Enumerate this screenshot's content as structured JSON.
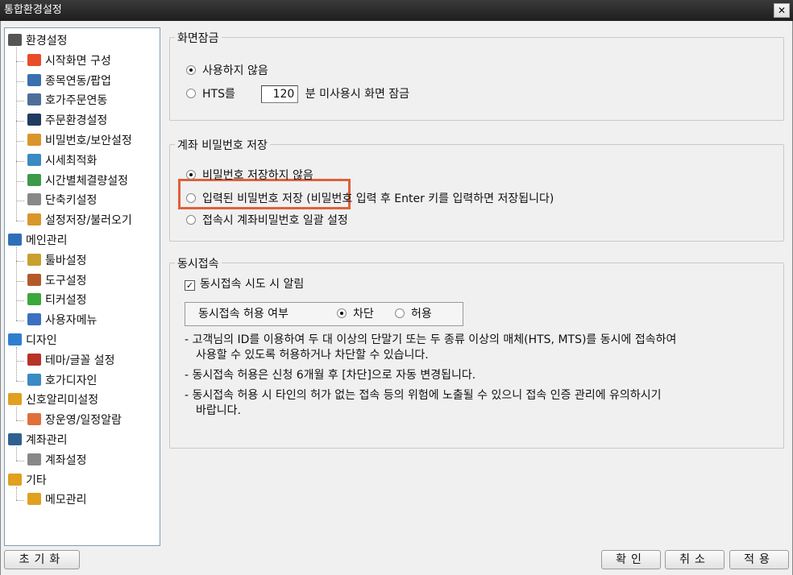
{
  "window": {
    "title": "통합환경설정",
    "close_label": "✕"
  },
  "tree": [
    {
      "label": "환경설정",
      "icon": "gear-icon",
      "color": "#555555"
    },
    {
      "label": "시작화면 구성",
      "icon": "windows-icon",
      "color": "#e84d2a"
    },
    {
      "label": "종목연동/팝업",
      "icon": "list-window-icon",
      "color": "#3a6fb0"
    },
    {
      "label": "호가주문연동",
      "icon": "monitor-icon",
      "color": "#4e6e9a"
    },
    {
      "label": "주문환경설정",
      "icon": "tools-window-icon",
      "color": "#1f3b60"
    },
    {
      "label": "비밀번호/보안설정",
      "icon": "key-icon",
      "color": "#d9962b"
    },
    {
      "label": "시세최적화",
      "icon": "chart-window-icon",
      "color": "#3a8ac4"
    },
    {
      "label": "시간별체결량설정",
      "icon": "clock-icon",
      "color": "#3c9a4a"
    },
    {
      "label": "단축키설정",
      "icon": "keyboard-icon",
      "color": "#888888"
    },
    {
      "label": "설정저장/불러오기",
      "icon": "lock-folder-icon",
      "color": "#d9962b"
    },
    {
      "label": "메인관리",
      "icon": "computer-icon",
      "color": "#2f6fb8"
    },
    {
      "label": "툴바설정",
      "icon": "wrench-icon",
      "color": "#c9a02d"
    },
    {
      "label": "도구설정",
      "icon": "toolbox-icon",
      "color": "#b35a2a"
    },
    {
      "label": "티커설정",
      "icon": "check-shield-icon",
      "color": "#3aa83a"
    },
    {
      "label": "사용자메뉴",
      "icon": "user-icon",
      "color": "#3c6fc2"
    },
    {
      "label": "디자인",
      "icon": "shapes-icon",
      "color": "#2f7fd1"
    },
    {
      "label": "테마/글꼴 설정",
      "icon": "font-icon",
      "color": "#b83227"
    },
    {
      "label": "호가디자인",
      "icon": "design-window-icon",
      "color": "#3a8ac4"
    },
    {
      "label": "신호알리미설정",
      "icon": "bell-icon",
      "color": "#e0a020"
    },
    {
      "label": "장운영/일정알람",
      "icon": "calendar-icon",
      "color": "#e0703a"
    },
    {
      "label": "계좌관리",
      "icon": "account-card-icon",
      "color": "#2f6090"
    },
    {
      "label": "계좌설정",
      "icon": "card-icon",
      "color": "#888888"
    },
    {
      "label": "기타",
      "icon": "folder-pencil-icon",
      "color": "#e0a020"
    },
    {
      "label": "메모관리",
      "icon": "memo-folder-icon",
      "color": "#e0a020"
    }
  ],
  "screen_lock": {
    "title": "화면잠금",
    "option_none": "사용하지 않음",
    "option_hts": "HTS를",
    "minutes_value": "120",
    "option_hts_suffix": "분 미사용시 화면 잠금",
    "selected": "none"
  },
  "account_pw": {
    "title": "계좌 비밀번호 저장",
    "option_nosave": "비밀번호 저장하지 않음",
    "option_save": "입력된 비밀번호 저장 (비밀번호 입력 후 Enter 키를 입력하면 저장됩니다)",
    "option_bulk": "접속시 계좌비밀번호 일괄 설정",
    "selected": "nosave"
  },
  "concurrent": {
    "title": "동시접속",
    "alert_label": "동시접속 시도 시 알림",
    "alert_checked": true,
    "allow_label": "동시접속 허용 여부",
    "block_label": "차단",
    "allow_option": "허용",
    "selected": "block",
    "notes": [
      "- 고객님의 ID를 이용하여 두 대 이상의 단말기 또는 두 종류 이상의 매체(HTS, MTS)를 동시에 접속하여",
      "사용할 수 있도록 허용하거나 차단할 수 있습니다.",
      "- 동시접속 허용은 신청 6개월 후 [차단]으로 자동 변경됩니다.",
      "- 동시접속 허용 시 타인의 허가 없는 접속 등의 위험에 노출될 수 있으니 접속 인증 관리에 유의하시기",
      "바랍니다."
    ]
  },
  "buttons": {
    "reset": "초기화",
    "ok": "확인",
    "cancel": "취소",
    "apply": "적용"
  },
  "colors": {
    "highlight": "#e0603a",
    "titlebar": "#2a2a2a"
  }
}
